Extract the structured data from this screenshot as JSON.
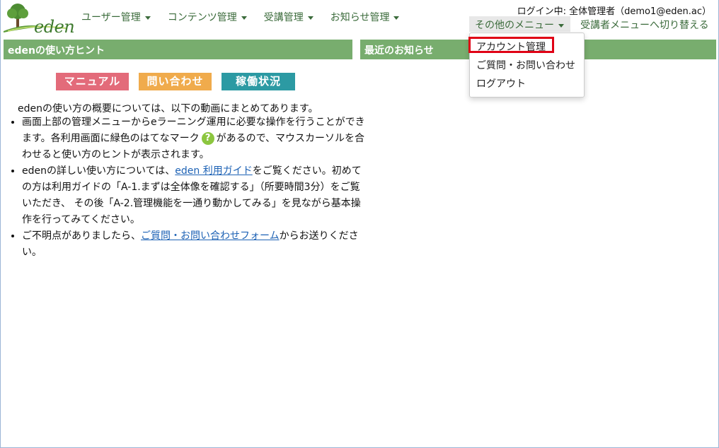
{
  "brand": {
    "logo_text": "eden"
  },
  "nav": {
    "items": [
      {
        "label": "ユーザー管理"
      },
      {
        "label": "コンテンツ管理"
      },
      {
        "label": "受講管理"
      },
      {
        "label": "お知らせ管理"
      }
    ],
    "login_status": "ログイン中: 全体管理者（demo1@eden.ac）",
    "other_menu_label": "その他のメニュー",
    "switch_label": "受講者メニューへ切り替える"
  },
  "dropdown": {
    "items": [
      {
        "label": "アカウント管理"
      },
      {
        "label": "ご質問・お問い合わせ"
      },
      {
        "label": "ログアウト"
      }
    ]
  },
  "hints_panel": {
    "title": "edenの使い方ヒント",
    "buttons": {
      "manual": "マニュアル",
      "contact": "問い合わせ",
      "status": "稼働状況"
    },
    "intro": "edenの使い方の概要については、以下の動画にまとめてあります。",
    "bullet1_text_a": "画面上部の管理メニューからeラーニング運用に必要な操作を行うことができます。各利用画面に緑色のはてなマーク",
    "bullet1_icon": "?",
    "bullet1_text_b": "があるので、マウスカーソルを合わせると使い方のヒントが表示されます。",
    "bullet2_text_a": "edenの詳しい使い方については、",
    "bullet2_link": "eden 利用ガイド",
    "bullet2_text_b": "をご覧ください。初めての方は利用ガイドの「A-1.まずは全体像を確認する」（所要時間3分）をご覧いただき、 その後「A-2.管理機能を一通り動かしてみる」を見ながら基本操作を行ってみてください。",
    "bullet3_text_a": "ご不明点がありましたら、",
    "bullet3_link": "ご質問・お問い合わせフォーム",
    "bullet3_text_b": "からお送りください。"
  },
  "news_panel": {
    "title": "最近のお知らせ"
  },
  "colors": {
    "panel_header": "#78ad6e",
    "highlight": "#e00015",
    "nav_text": "#3b6b3b"
  }
}
